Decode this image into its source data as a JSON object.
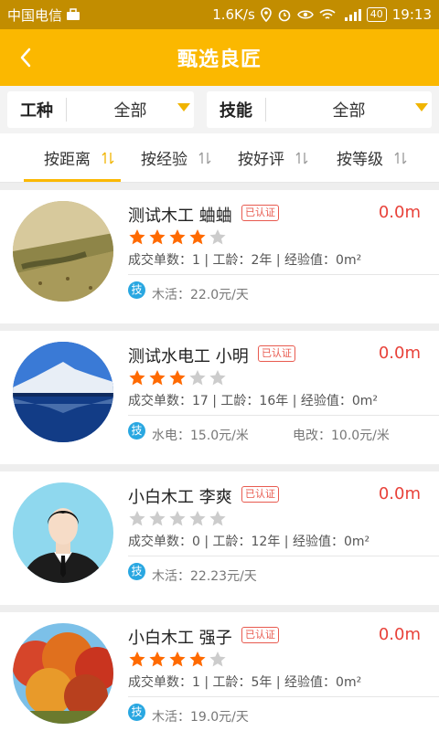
{
  "status_bar": {
    "carrier": "中国电信",
    "speed": "1.6K/s",
    "battery": "40",
    "time": "19:13"
  },
  "header": {
    "title": "甄选良匠"
  },
  "filters": [
    {
      "name": "工种",
      "value": "全部"
    },
    {
      "name": "技能",
      "value": "全部"
    }
  ],
  "sort_tabs": [
    "按距离",
    "按经验",
    "按好评",
    "按等级"
  ],
  "active_sort": "按距离",
  "skill_badge": "技",
  "verified_label": "已认证",
  "craftsmen": [
    {
      "name": "测试木工 蛐蛐",
      "distance": "0.0m",
      "rating": 4,
      "stats": "成交单数：1 | 工龄：2年 | 经验值：0m²",
      "prices": [
        "木活：22.0元/天"
      ],
      "avatar": "field-landscape"
    },
    {
      "name": "测试水电工 小明",
      "distance": "0.0m",
      "rating": 3,
      "stats": "成交单数：17 | 工龄：16年 | 经验值：0m²",
      "prices": [
        "水电：15.0元/米",
        "电改：10.0元/米"
      ],
      "avatar": "lake-mountain"
    },
    {
      "name": "小白木工 李爽",
      "distance": "0.0m",
      "rating": 0,
      "stats": "成交单数：0 | 工龄：12年 | 经验值：0m²",
      "prices": [
        "木活：22.23元/天"
      ],
      "avatar": "businessman"
    },
    {
      "name": "小白木工 强子",
      "distance": "0.0m",
      "rating": 4,
      "stats": "成交单数：1 | 工龄：5年 | 经验值：0m²",
      "prices": [
        "木活：19.0元/天"
      ],
      "avatar": "autumn-trees"
    }
  ],
  "colors": {
    "primary": "#fbb800",
    "status_bar": "#c28d00",
    "distance": "#e8423a",
    "star_on": "#ff6a00",
    "star_off": "#cccccc",
    "badge": "#e85a4f",
    "skill": "#29a7e1"
  }
}
